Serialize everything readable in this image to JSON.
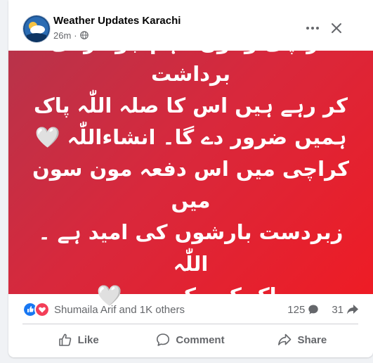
{
  "post": {
    "page_name": "Weather Updates Karachi",
    "time": "26m",
    "separator": "·",
    "text_lines": [
      "کراچی والوں ، ہم جو گرمی برداشت",
      "کر رہے ہیں اس کا صلہ اللّٰہ پاک",
      "ہمیں ضرور دے گا۔ انشاءاللّٰہ",
      "کراچی میں اس دفعہ مون سون میں",
      "زبردست بارشوں کی امید ہے ۔ اللّٰہ",
      "پاک کے حکم سے"
    ],
    "heart_emoji": "🤍",
    "banner_colors": [
      "#b8334a",
      "#ee1c25"
    ]
  },
  "reactions": {
    "label": "Shumaila Arif and 1K others",
    "icons": [
      "like-icon",
      "love-icon"
    ],
    "comments_count": "125",
    "shares_count": "31"
  },
  "actions": {
    "like": "Like",
    "comment": "Comment",
    "share": "Share"
  },
  "colors": {
    "secondary_text": "#65676b",
    "like_blue": "#1877f2",
    "love_red": "#f33e58"
  }
}
